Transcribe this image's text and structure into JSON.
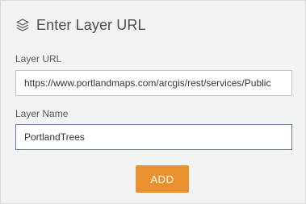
{
  "dialog": {
    "title": "Enter Layer URL",
    "icon": "layers-icon"
  },
  "layer_url": {
    "label": "Layer URL",
    "value": "https://www.portlandmaps.com/arcgis/rest/services/Public"
  },
  "layer_name": {
    "label": "Layer Name",
    "value": "PortlandTrees"
  },
  "actions": {
    "add_label": "ADD"
  },
  "colors": {
    "panel_bg": "#f3f3f3",
    "accent_button": "#e8912e",
    "focus_border": "#5b7fa8"
  }
}
